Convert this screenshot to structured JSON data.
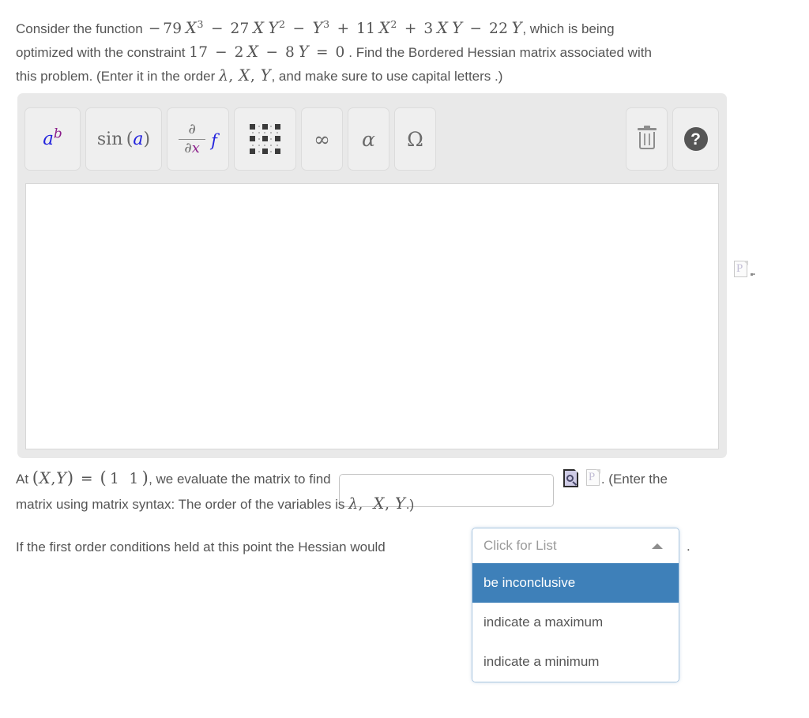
{
  "question": {
    "line1_prefix": "Consider the function",
    "expression": "−79 X³ − 27 X Y² − Y³ + 11 X² + 3 X Y − 22 Y",
    "line1_suffix": ", which is being",
    "line2_prefix": "optimized with the constraint",
    "constraint": "17 − 2 X − 8 Y = 0",
    "line2_suffix": ". Find the Bordered Hessian matrix associated with",
    "line3": "this problem. (Enter it in the order λ, X, Y, and make sure to use capital letters .)",
    "line3_prefix": "this problem. (Enter it in the order",
    "order_vars": "λ, X, Y",
    "line3_suffix": ", and make sure to use capital letters .)"
  },
  "editor": {
    "toolbar": [
      {
        "name": "power",
        "label": "aᵇ",
        "base": "a",
        "exponent": "b"
      },
      {
        "name": "function",
        "label": "sin (a)",
        "fn": "sin",
        "open": "(",
        "arg": "a",
        "close": ")"
      },
      {
        "name": "derivative",
        "label": "∂/∂x f",
        "numerator": "∂",
        "denominator_d": "∂",
        "denominator_x": "x",
        "func": "f"
      },
      {
        "name": "matrix",
        "label": "matrix-grid"
      },
      {
        "name": "infinity",
        "label": "∞"
      },
      {
        "name": "alpha",
        "label": "α"
      },
      {
        "name": "omega",
        "label": "Ω"
      },
      {
        "name": "delete",
        "label": "trash"
      },
      {
        "name": "help",
        "label": "?"
      }
    ],
    "canvas_value": "",
    "side_icon_glyph": "P",
    "side_icon_period": "."
  },
  "evaluate": {
    "prefix_at": "At",
    "point_lhs": "(X, Y) =",
    "point_rhs": "( 1   1 )",
    "after_point": ", we evaluate the matrix to find",
    "input_value": "",
    "input_placeholder": "",
    "preview_icon_name": "page-magnifier",
    "broken_icon_glyph": "P",
    "after_icons": ". (Enter the",
    "line2": "matrix using matrix syntax: The order of the variables is λ,  X, Y .)",
    "line2_prefix": "matrix using matrix syntax: The order of the variables is",
    "line2_vars": "λ,  X, Y",
    "line2_suffix": ".)"
  },
  "conclusion": {
    "text": "If the first order conditions held at this point the Hessian would",
    "trailing_period": "."
  },
  "dropdown": {
    "placeholder": "Click for List",
    "expanded": true,
    "caret": "caret-up",
    "selected_index": 0,
    "highlight_color": "#3e80b9",
    "options": [
      {
        "label": "be inconclusive",
        "selected": true
      },
      {
        "label": "indicate a maximum",
        "selected": false
      },
      {
        "label": "indicate a minimum",
        "selected": false
      }
    ]
  },
  "colors": {
    "text": "#555555",
    "panel_bg": "#e9e9e9",
    "button_bg": "#efefef",
    "accent_blue": "#3e80b9",
    "var_blue": "#2222dd",
    "var_purple": "#8b1f8b"
  }
}
